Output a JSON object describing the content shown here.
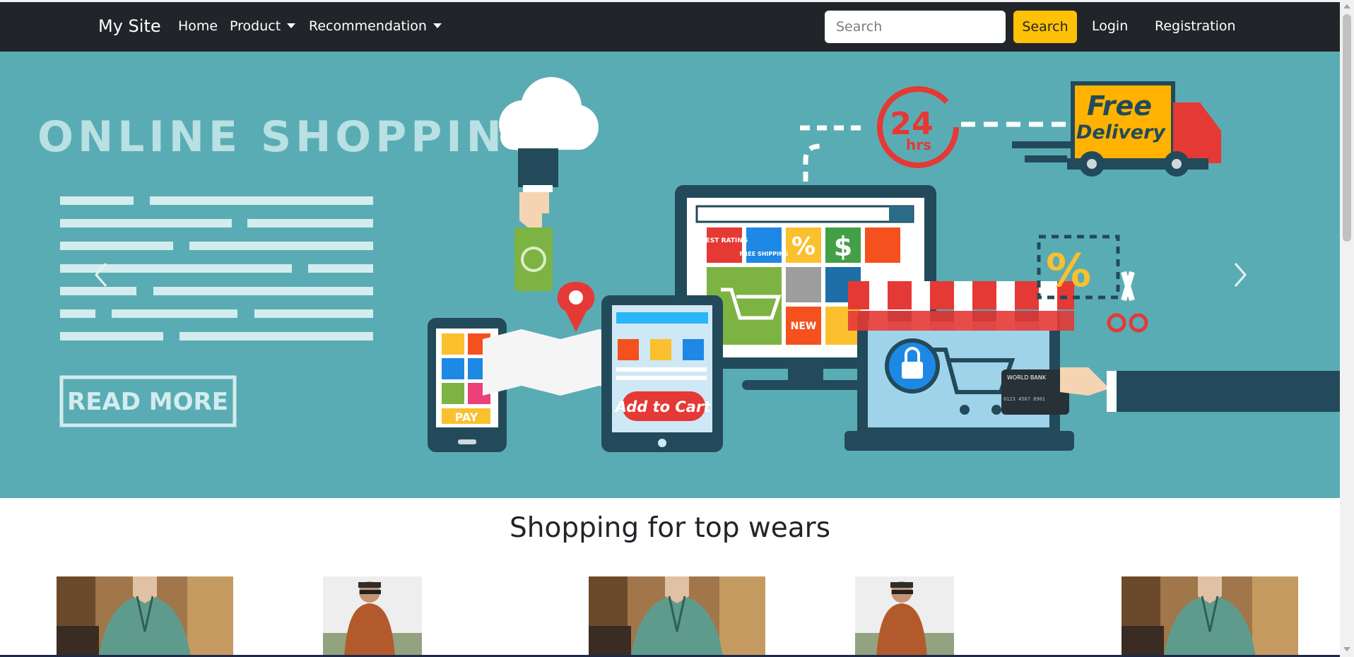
{
  "navbar": {
    "brand": "My Site",
    "home": "Home",
    "product": "Product",
    "recommendation": "Recommendation",
    "search_placeholder": "Search",
    "search_button": "Search",
    "login": "Login",
    "registration": "Registration"
  },
  "carousel": {
    "headline": "ONLINE  SHOPPING",
    "read_more": "READ MORE",
    "delivery_line1": "Free",
    "delivery_line2": "Delivery",
    "hours_24": "24",
    "hours_label": "hrs",
    "add_to_cart": "Add to Cart",
    "pay": "PAY",
    "best_rating": "BEST RATING",
    "free_shipping": "FREE SHIPPING",
    "new_badge": "NEW",
    "world_bank": "WORLD BANK",
    "card_number": "0123 4567 8901",
    "prev_icon": "chevron-left-icon",
    "next_icon": "chevron-right-icon"
  },
  "section": {
    "heading": "Shopping for top wears"
  },
  "products": [
    {
      "name": "green shirt"
    },
    {
      "name": "orange shirt"
    },
    {
      "name": "green shirt"
    },
    {
      "name": "orange shirt"
    },
    {
      "name": "green shirt"
    }
  ],
  "colors": {
    "navbar": "#212529",
    "accent": "#ffc107",
    "banner": "#5aacb4"
  }
}
